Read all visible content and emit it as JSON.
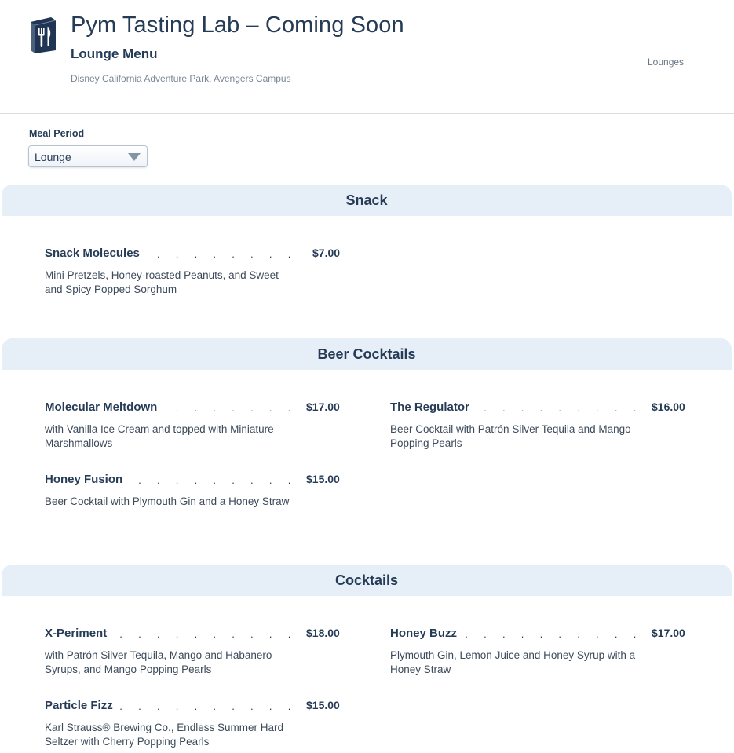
{
  "header": {
    "title": "Pym Tasting Lab – Coming Soon",
    "subtitle": "Lounge Menu",
    "location": "Disney California Adventure Park, Avengers Campus",
    "category_link": "Lounges",
    "logo_icon": "menu-utensils-icon"
  },
  "meal_period": {
    "label": "Meal Period",
    "selected": "Lounge"
  },
  "sections": [
    {
      "title": "Snack",
      "items": [
        {
          "name": "Snack Molecules",
          "price": "$7.00",
          "description": "Mini Pretzels, Honey-roasted Peanuts, and Sweet and Spicy Popped Sorghum"
        }
      ]
    },
    {
      "title": "Beer Cocktails",
      "items": [
        {
          "name": "Molecular Meltdown",
          "price": "$17.00",
          "description": "with Vanilla Ice Cream and topped with Miniature Marshmallows"
        },
        {
          "name": "The Regulator",
          "price": "$16.00",
          "description": "Beer Cocktail with Patrón Silver Tequila and Mango Popping Pearls"
        },
        {
          "name": "Honey Fusion",
          "price": "$15.00",
          "description": "Beer Cocktail with Plymouth Gin and a Honey Straw"
        }
      ]
    },
    {
      "title": "Cocktails",
      "items": [
        {
          "name": "X-Periment",
          "price": "$18.00",
          "description": "with Patrón Silver Tequila, Mango and Habanero Syrups, and Mango Popping Pearls"
        },
        {
          "name": "Honey Buzz",
          "price": "$17.00",
          "description": "Plymouth Gin, Lemon Juice and Honey Syrup with a Honey Straw"
        },
        {
          "name": "Particle Fizz",
          "price": "$15.00",
          "description": "Karl Strauss® Brewing Co., Endless Summer Hard Seltzer with Cherry Popping Pearls"
        }
      ]
    }
  ],
  "colors": {
    "text": "#253b56",
    "band": "#e6eef7",
    "muted": "#7a8794"
  }
}
